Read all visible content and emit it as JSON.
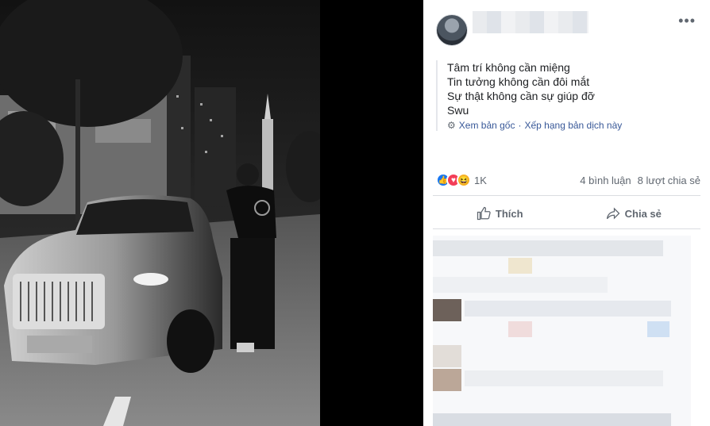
{
  "post": {
    "more_icon": "more-horizontal-icon",
    "caption_lines": [
      "Tâm trí không cần miệng",
      "Tin tưởng không cần đôi mắt",
      "Sự thật không cần sự giúp đỡ",
      "Swu"
    ],
    "translate": {
      "see_original": "Xem bản gốc",
      "separator": "·",
      "rate_translation": "Xếp hạng bản dịch này"
    },
    "reactions": {
      "count": "1K",
      "comments": "4 bình luận",
      "shares": "8 lượt chia sẻ"
    },
    "actions": {
      "like": "Thích",
      "share": "Chia sẻ"
    },
    "colors": {
      "link": "#385898",
      "like_blue": "#1877f2",
      "love_red": "#f33e58",
      "haha_yellow": "#f7b125"
    }
  }
}
